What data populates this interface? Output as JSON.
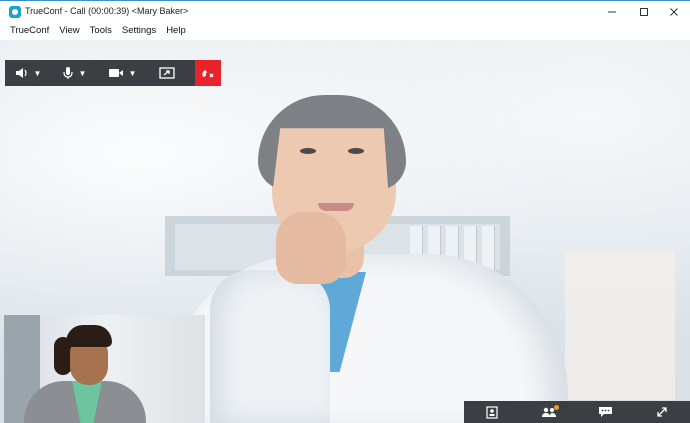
{
  "window": {
    "title": "TrueConf - Call (00:00:39)  <Mary Baker>",
    "controls": [
      "minimize",
      "maximize",
      "close"
    ]
  },
  "menu": {
    "items": [
      "TrueConf",
      "View",
      "Tools",
      "Settings",
      "Help"
    ]
  },
  "toolbar": {
    "buttons": [
      {
        "icon": "speaker-icon",
        "has_dropdown": true
      },
      {
        "icon": "microphone-icon",
        "has_dropdown": true
      },
      {
        "icon": "camera-icon",
        "has_dropdown": true
      },
      {
        "icon": "screen-share-icon",
        "has_dropdown": false
      },
      {
        "icon": "hang-up-icon",
        "has_dropdown": false
      }
    ],
    "caret": "▼"
  },
  "bottom_bar": {
    "buttons": [
      {
        "icon": "address-book-icon"
      },
      {
        "icon": "participants-icon",
        "badge": true
      },
      {
        "icon": "chat-icon"
      },
      {
        "icon": "expand-icon"
      }
    ]
  },
  "colors": {
    "toolbar_bg": "#3b3e42",
    "hangup_red": "#e7232c",
    "badge_orange": "#f39c1f",
    "app_icon": "#1aa3cf"
  }
}
